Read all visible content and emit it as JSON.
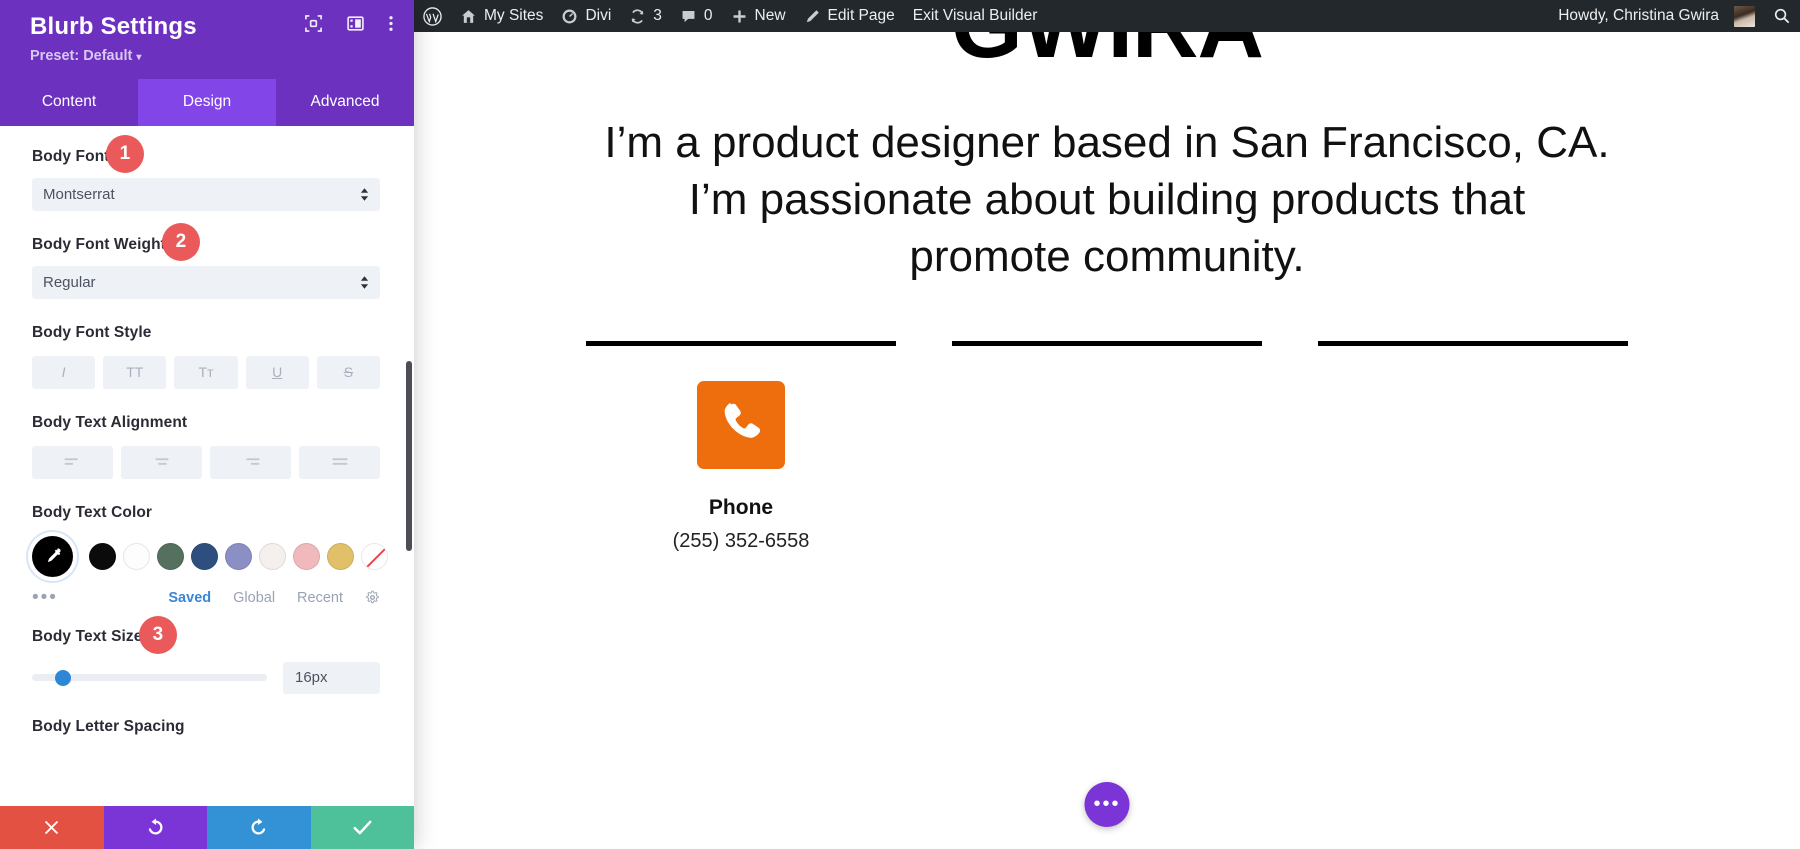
{
  "adminbar": {
    "items": [
      {
        "icon": "wordpress-logo-icon",
        "label": ""
      },
      {
        "icon": "home-icon",
        "label": "My Sites"
      },
      {
        "icon": "gauge-icon",
        "label": "Divi"
      },
      {
        "icon": "updates-icon",
        "label": "3"
      },
      {
        "icon": "comment-icon",
        "label": "0"
      },
      {
        "icon": "plus-icon",
        "label": "New"
      },
      {
        "icon": "pencil-icon",
        "label": "Edit Page"
      },
      {
        "icon": "",
        "label": "Exit Visual Builder"
      }
    ],
    "greeting": "Howdy, Christina Gwira",
    "search_icon": "search-icon"
  },
  "panel": {
    "title": "Blurb Settings",
    "preset_label": "Preset: Default",
    "preset_caret": "▾",
    "header_icons": [
      "target-focus-icon",
      "panel-layout-icon",
      "vertical-dots-icon"
    ],
    "tabs": [
      {
        "label": "Content",
        "active": false
      },
      {
        "label": "Design",
        "active": true
      },
      {
        "label": "Advanced",
        "active": false
      }
    ],
    "accent_color": "#6d31c0",
    "accent_active_color": "#8245e8",
    "badge_color": "#ea5a5a",
    "fields": {
      "body_font": {
        "label": "Body Font",
        "value": "Montserrat",
        "badge": "1"
      },
      "body_font_weight": {
        "label": "Body Font Weight",
        "value": "Regular",
        "badge": "2"
      },
      "body_font_style": {
        "label": "Body Font Style",
        "buttons": [
          {
            "name": "italic",
            "glyph": "I"
          },
          {
            "name": "uppercase",
            "glyph": "TT"
          },
          {
            "name": "small-caps",
            "glyph": "Tт"
          },
          {
            "name": "underline",
            "glyph": "U"
          },
          {
            "name": "strikethrough",
            "glyph": "S"
          }
        ]
      },
      "body_text_alignment": {
        "label": "Body Text Alignment",
        "buttons": [
          {
            "name": "align-left"
          },
          {
            "name": "align-center"
          },
          {
            "name": "align-right"
          },
          {
            "name": "align-justify"
          }
        ]
      },
      "body_text_color": {
        "label": "Body Text Color",
        "picker_icon": "eyedropper-icon",
        "picker_bg": "#000000",
        "swatches": [
          "#0b0b0b",
          "#fdfdfd",
          "#56705f",
          "#2e4f7d",
          "#8b8fc4",
          "#f5f0ee",
          "#f0b9bb",
          "#e0c068",
          "none"
        ],
        "more_dots": "•••",
        "links": [
          {
            "label": "Saved",
            "active": true
          },
          {
            "label": "Global",
            "active": false
          },
          {
            "label": "Recent",
            "active": false
          }
        ],
        "gear_icon": "gear-icon"
      },
      "body_text_size": {
        "label": "Body Text Size",
        "badge": "3",
        "value": "16px",
        "handle_percent": 13
      },
      "body_letter_spacing": {
        "label": "Body Letter Spacing"
      }
    },
    "footer_buttons": [
      {
        "name": "discard-changes",
        "icon": "close-x-icon",
        "color": "#e25141"
      },
      {
        "name": "undo",
        "icon": "undo-arrow-icon",
        "color": "#7b35d6"
      },
      {
        "name": "redo",
        "icon": "redo-arrow-icon",
        "color": "#3392d6"
      },
      {
        "name": "save-changes",
        "icon": "checkmark-icon",
        "color": "#4ec19a"
      }
    ]
  },
  "canvas": {
    "wordmark": "GWIRA",
    "headline": "I’m a product designer based in San Francisco, CA. I’m passionate about building products that promote community.",
    "columns": [
      {
        "icon": "phone-icon",
        "icon_color": "#ee6d0c",
        "title": "Phone",
        "text": "(255) 352-6558"
      },
      {
        "icon": "",
        "icon_color": "",
        "title": "",
        "text": ""
      },
      {
        "icon": "",
        "icon_color": "",
        "title": "",
        "text": ""
      }
    ],
    "fab_icon": "ellipsis-icon",
    "fab_label": "•••"
  }
}
